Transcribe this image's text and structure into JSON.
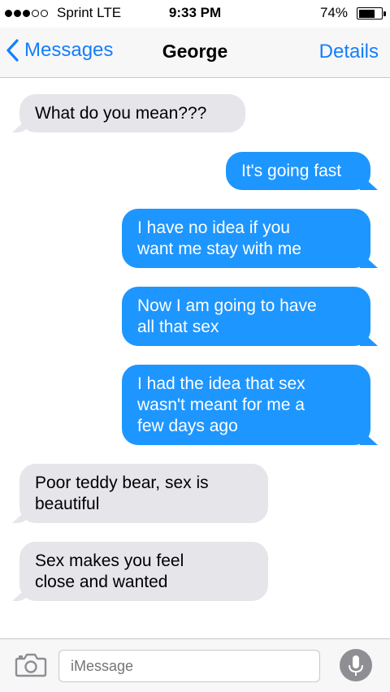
{
  "status_bar": {
    "signal": [
      true,
      true,
      true,
      false,
      false
    ],
    "carrier": "Sprint  LTE",
    "time": "9:33 PM",
    "battery_percent": "74%",
    "battery_level": 0.74
  },
  "nav": {
    "back_label": "Messages",
    "title": "George",
    "details_label": "Details",
    "accent_color": "#157efb"
  },
  "messages": [
    {
      "direction": "incoming",
      "lines": [
        "What do you mean???"
      ]
    },
    {
      "direction": "outgoing",
      "lines": [
        "It's going fast"
      ]
    },
    {
      "direction": "outgoing",
      "lines": [
        "I have no idea if you",
        "want me stay with me"
      ]
    },
    {
      "direction": "outgoing",
      "lines": [
        "Now I am going to have",
        "all that sex"
      ]
    },
    {
      "direction": "outgoing",
      "lines": [
        "I had the idea that sex",
        "wasn't meant for me a",
        "few days ago"
      ]
    },
    {
      "direction": "incoming",
      "lines": [
        "Poor teddy bear, sex is",
        "beautiful"
      ]
    },
    {
      "direction": "incoming",
      "lines": [
        "Sex makes you feel",
        "close and wanted"
      ]
    }
  ],
  "input": {
    "placeholder": "iMessage",
    "camera_icon": "camera-icon",
    "mic_icon": "microphone-icon"
  },
  "colors": {
    "incoming_bubble": "#e5e5ea",
    "outgoing_bubble": "#1e96ff"
  }
}
